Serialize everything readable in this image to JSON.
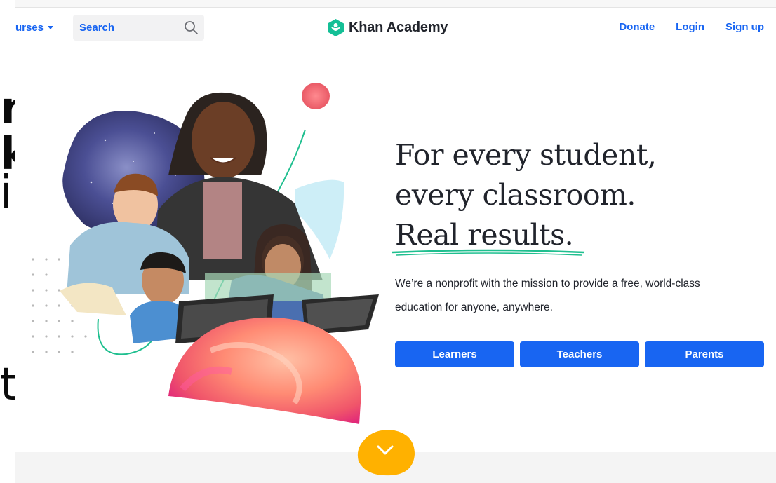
{
  "edge_fragments": [
    "nt",
    "k",
    "i'",
    "t"
  ],
  "header": {
    "courses_label": "urses",
    "search_placeholder": "Search",
    "logo_text": "Khan Academy",
    "donate": "Donate",
    "login": "Login",
    "signup": "Sign up"
  },
  "hero": {
    "headline_lines": [
      "For every student,",
      "every classroom.",
      "Real results."
    ],
    "mission_lines": [
      "We’re a nonprofit with the mission to provide a free, world-class",
      "education for anyone, anywhere."
    ],
    "buttons": [
      "Learners",
      "Teachers",
      "Parents"
    ]
  },
  "colors": {
    "brand_blue": "#1865f2",
    "logo_green": "#14bf96",
    "text_dark": "#21242c",
    "accent_coral": "#f0556a",
    "accent_yellow": "#ffb100"
  },
  "icons": [
    "search-icon",
    "khan-logo-icon",
    "chevron-down-icon"
  ]
}
